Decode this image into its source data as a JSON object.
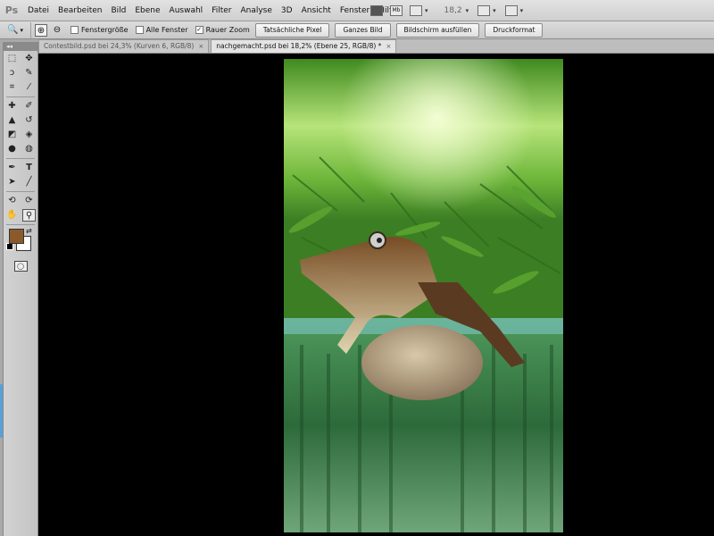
{
  "app": {
    "logo": "Ps"
  },
  "menu": {
    "items": [
      {
        "label": "Datei"
      },
      {
        "label": "Bearbeiten"
      },
      {
        "label": "Bild"
      },
      {
        "label": "Ebene"
      },
      {
        "label": "Auswahl"
      },
      {
        "label": "Filter"
      },
      {
        "label": "Analyse"
      },
      {
        "label": "3D"
      },
      {
        "label": "Ansicht"
      },
      {
        "label": "Fenster"
      },
      {
        "label": "Hilfe"
      }
    ],
    "mb_label": "Mb",
    "zoom_value": "18,2"
  },
  "options": {
    "checkboxes": [
      {
        "label": "Fenstergröße",
        "checked": false
      },
      {
        "label": "Alle Fenster",
        "checked": false
      },
      {
        "label": "Rauer Zoom",
        "checked": true
      }
    ],
    "buttons": [
      {
        "label": "Tatsächliche Pixel"
      },
      {
        "label": "Ganzes Bild"
      },
      {
        "label": "Bildschirm ausfüllen"
      },
      {
        "label": "Druckformat"
      }
    ],
    "check_mark": "✓"
  },
  "tabs": [
    {
      "label": "Contestbild.psd bei 24,3% (Kurven 6, RGB/8)"
    },
    {
      "label": "nachgemacht.psd bei 18,2% (Ebene 25, RGB/8) *"
    }
  ],
  "toolbox": {
    "header": "◂◂",
    "foreground_color": "#8a5a2b",
    "background_color": "#ffffff"
  },
  "icons": {
    "zoom": "🔍",
    "zoom_in": "⊕",
    "zoom_out": "⊖",
    "close": "×",
    "caret": "▾",
    "tools": [
      "marquee-icon",
      "move-icon",
      "lasso-icon",
      "quick-select-icon",
      "crop-icon",
      "eyedropper-icon",
      "healing-icon",
      "brush-icon",
      "stamp-icon",
      "history-brush-icon",
      "eraser-icon",
      "bucket-icon",
      "blur-icon",
      "dodge-icon",
      "pen-icon",
      "type-icon",
      "path-select-icon",
      "line-icon",
      "3d-rotate-icon",
      "3d-orbit-icon",
      "hand-icon",
      "zoom-tool-icon"
    ]
  }
}
